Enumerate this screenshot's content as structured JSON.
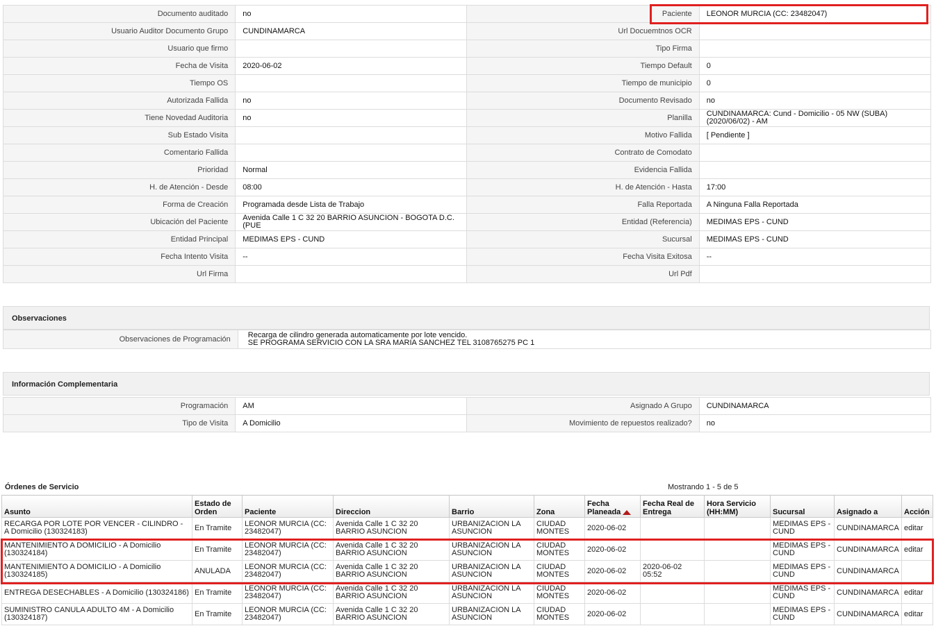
{
  "details": {
    "rows": [
      {
        "l1": "Documento auditado",
        "v1": "no",
        "l2": "Paciente",
        "v2": "LEONOR MURCIA (CC: 23482047)"
      },
      {
        "l1": "Usuario Auditor Documento Grupo",
        "v1": "CUNDINAMARCA",
        "l2": "Url Docuemtnos OCR",
        "v2": ""
      },
      {
        "l1": "Usuario que firmo",
        "v1": "",
        "l2": "Tipo Firma",
        "v2": ""
      },
      {
        "l1": "Fecha de Visita",
        "v1": "2020-06-02",
        "l2": "Tiempo Default",
        "v2": "0"
      },
      {
        "l1": "Tiempo OS",
        "v1": "",
        "l2": "Tiempo de municipio",
        "v2": "0"
      },
      {
        "l1": "Autorizada Fallida",
        "v1": "no",
        "l2": "Documento Revisado",
        "v2": "no"
      },
      {
        "l1": "Tiene Novedad Auditoria",
        "v1": "no",
        "l2": "Planilla",
        "v2": "CUNDINAMARCA: Cund - Domicilio - 05 NW (SUBA) (2020/06/02) - AM"
      },
      {
        "l1": "Sub Estado Visita",
        "v1": "",
        "l2": "Motivo Fallida",
        "v2": "[ Pendiente ]"
      },
      {
        "l1": "Comentario Fallida",
        "v1": "",
        "l2": "Contrato de Comodato",
        "v2": ""
      },
      {
        "l1": "Prioridad",
        "v1": "Normal",
        "l2": "Evidencia Fallida",
        "v2": ""
      },
      {
        "l1": "H. de Atención - Desde",
        "v1": "08:00",
        "l2": "H. de Atención - Hasta",
        "v2": "17:00"
      },
      {
        "l1": "Forma de Creación",
        "v1": "Programada desde Lista de Trabajo",
        "l2": "Falla Reportada",
        "v2": "A Ninguna Falla Reportada"
      },
      {
        "l1": "Ubicación del Paciente",
        "v1": "Avenida Calle 1 C 32 20 BARRIO ASUNCION - BOGOTA D.C. (PUE",
        "l2": "Entidad (Referencia)",
        "v2": "MEDIMAS EPS - CUND"
      },
      {
        "l1": "Entidad Principal",
        "v1": "MEDIMAS EPS - CUND",
        "l2": "Sucursal",
        "v2": "MEDIMAS EPS - CUND"
      },
      {
        "l1": "Fecha Intento Visita",
        "v1": "--",
        "l2": "Fecha Visita Exitosa",
        "v2": "--"
      },
      {
        "l1": "Url Firma",
        "v1": "",
        "l2": "Url Pdf",
        "v2": ""
      }
    ]
  },
  "observaciones": {
    "title": "Observaciones",
    "label": "Observaciones de Programación",
    "line1": "Recarga de cilindro generada automaticamente por lote vencido.",
    "line2": "SE PROGRAMA SERVICIO CON LA SRA MARIA SANCHEZ TEL 3108765275 PC 1"
  },
  "complementaria": {
    "title": "Información Complementaria",
    "rows": [
      {
        "l1": "Programación",
        "v1": "AM",
        "l2": "Asignado A Grupo",
        "v2": "CUNDINAMARCA"
      },
      {
        "l1": "Tipo de Visita",
        "v1": "A Domicilio",
        "l2": "Movimiento de repuestos realizado?",
        "v2": "no"
      }
    ]
  },
  "orders": {
    "title": "Órdenes de Servicio",
    "showing": "Mostrando 1 - 5 de 5",
    "headers": [
      "Asunto",
      "Estado de Orden",
      "Paciente",
      "Direccion",
      "Barrio",
      "Zona",
      "Fecha Planeada",
      "Fecha Real de Entrega",
      "Hora Servicio (HH:MM)",
      "Sucursal",
      "Asignado a",
      "Acción"
    ],
    "rows": [
      {
        "asunto": "RECARGA POR LOTE POR VENCER - CILINDRO - A Domicilio (130324183)",
        "estado": "En Tramite",
        "paciente": "LEONOR MURCIA (CC: 23482047)",
        "direccion": "Avenida Calle 1 C 32 20 BARRIO ASUNCION",
        "barrio": "URBANIZACION LA ASUNCION",
        "zona": "CIUDAD MONTES",
        "fecha": "2020-06-02",
        "real": "",
        "hora": "",
        "sucursal": "MEDIMAS EPS - CUND",
        "asignado": "CUNDINAMARCA",
        "accion": "editar"
      },
      {
        "asunto": "MANTENIMIENTO A DOMICILIO - A Domicilio (130324184)",
        "estado": "En Tramite",
        "paciente": "LEONOR MURCIA (CC: 23482047)",
        "direccion": "Avenida Calle 1 C 32 20 BARRIO ASUNCION",
        "barrio": "URBANIZACION LA ASUNCION",
        "zona": "CIUDAD MONTES",
        "fecha": "2020-06-02",
        "real": "",
        "hora": "",
        "sucursal": "MEDIMAS EPS - CUND",
        "asignado": "CUNDINAMARCA",
        "accion": "editar"
      },
      {
        "asunto": "MANTENIMIENTO A DOMICILIO - A Domicilio (130324185)",
        "estado": "ANULADA",
        "paciente": "LEONOR MURCIA (CC: 23482047)",
        "direccion": "Avenida Calle 1 C 32 20 BARRIO ASUNCION",
        "barrio": "URBANIZACION LA ASUNCION",
        "zona": "CIUDAD MONTES",
        "fecha": "2020-06-02",
        "real": "2020-06-02 05:52",
        "hora": "",
        "sucursal": "MEDIMAS EPS - CUND",
        "asignado": "CUNDINAMARCA",
        "accion": ""
      },
      {
        "asunto": "ENTREGA DESECHABLES - A Domicilio (130324186)",
        "estado": "En Tramite",
        "paciente": "LEONOR MURCIA (CC: 23482047)",
        "direccion": "Avenida Calle 1 C 32 20 BARRIO ASUNCION",
        "barrio": "URBANIZACION LA ASUNCION",
        "zona": "CIUDAD MONTES",
        "fecha": "2020-06-02",
        "real": "",
        "hora": "",
        "sucursal": "MEDIMAS EPS - CUND",
        "asignado": "CUNDINAMARCA",
        "accion": "editar"
      },
      {
        "asunto": "SUMINISTRO CANULA ADULTO 4M - A Domicilio (130324187)",
        "estado": "En Tramite",
        "paciente": "LEONOR MURCIA (CC: 23482047)",
        "direccion": "Avenida Calle 1 C 32 20 BARRIO ASUNCION",
        "barrio": "URBANIZACION LA ASUNCION",
        "zona": "CIUDAD MONTES",
        "fecha": "2020-06-02",
        "real": "",
        "hora": "",
        "sucursal": "MEDIMAS EPS - CUND",
        "asignado": "CUNDINAMARCA",
        "accion": "editar"
      }
    ]
  },
  "colors": {
    "highlight": "#e02020",
    "sort_arrow": "#b31b1b"
  }
}
